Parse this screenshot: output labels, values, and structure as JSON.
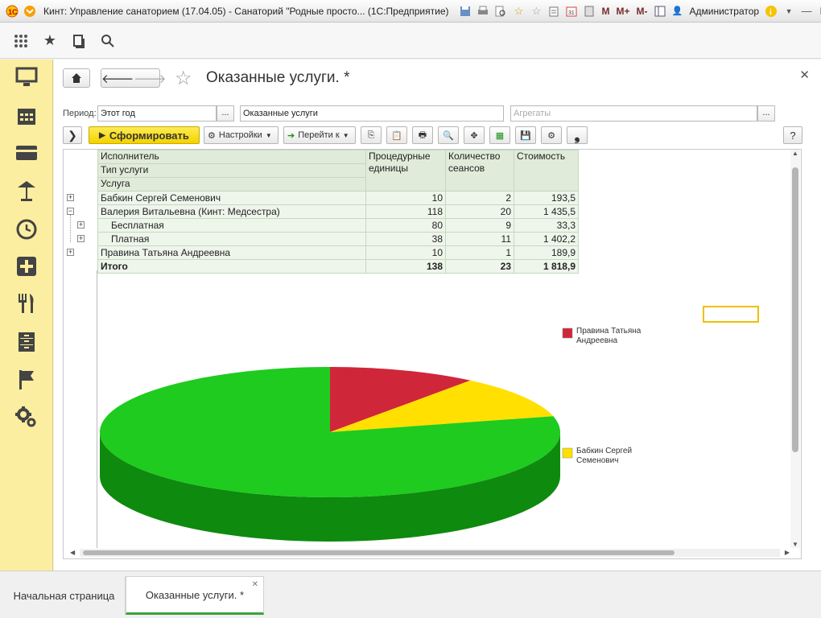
{
  "window": {
    "title": "Кинт: Управление санаторием (17.04.05) - Санаторий \"Родные просто...  (1С:Предприятие)",
    "user": "Администратор",
    "m_buttons": [
      "M",
      "M+",
      "M-"
    ]
  },
  "sidebar": {
    "items": [
      "monitor-icon",
      "calendar-icon",
      "card-icon",
      "lamp-icon",
      "clock-icon",
      "cross-icon",
      "fork-knife-icon",
      "cabinet-icon",
      "flag-icon",
      "gears-icon"
    ]
  },
  "form": {
    "title": "Оказанные услуги. *",
    "period_label": "Период:",
    "period_value": "Этот год",
    "dots": "...",
    "report_variant": "Оказанные услуги",
    "aggregates_placeholder": "Агрегаты",
    "generate_label": "Сформировать",
    "settings_label": "Настройки",
    "goto_label": "Перейти к",
    "help_label": "?"
  },
  "table": {
    "headers": {
      "executor": "Исполнитель",
      "service_type": "Тип услуги",
      "service": "Услуга",
      "units": "Процедурные единицы",
      "sessions": "Количество сеансов",
      "cost": "Стоимость"
    },
    "rows": [
      {
        "name": "Бабкин Сергей Семенович",
        "units": "10",
        "sessions": "2",
        "cost": "193,5"
      },
      {
        "name": "Валерия Витальевна (Кинт: Медсестра)",
        "units": "118",
        "sessions": "20",
        "cost": "1 435,5"
      },
      {
        "name": "Бесплатная",
        "units": "80",
        "sessions": "9",
        "cost": "33,3"
      },
      {
        "name": "Платная",
        "units": "38",
        "sessions": "11",
        "cost": "1 402,2"
      },
      {
        "name": "Правина Татьяна Андреевна",
        "units": "10",
        "sessions": "1",
        "cost": "189,9"
      }
    ],
    "total": {
      "name": "Итого",
      "units": "138",
      "sessions": "23",
      "cost": "1 818,9"
    }
  },
  "chart_data": {
    "type": "pie",
    "series": [
      {
        "name": "Правина Татьяна Андреевна",
        "value": 189.9,
        "color": "#d0263a"
      },
      {
        "name": "Бабкин Сергей Семенович",
        "value": 193.5,
        "color": "#ffe000"
      },
      {
        "name": "",
        "value": 1435.5,
        "color": "#1ecb1e"
      }
    ],
    "legend": [
      {
        "line1": "Правина Татьяна",
        "line2": "Андреевна",
        "color": "#d0263a"
      },
      {
        "line1": "Бабкин Сергей",
        "line2": "Семенович",
        "color": "#ffe000"
      }
    ]
  },
  "tabs": [
    {
      "label": "Начальная страница",
      "active": false
    },
    {
      "label": "Оказанные услуги. *",
      "active": true
    }
  ],
  "colors": {
    "accent": "#fbeea0",
    "pie_green": "#1ecb1e",
    "pie_green_dark": "#0e8a0e"
  }
}
